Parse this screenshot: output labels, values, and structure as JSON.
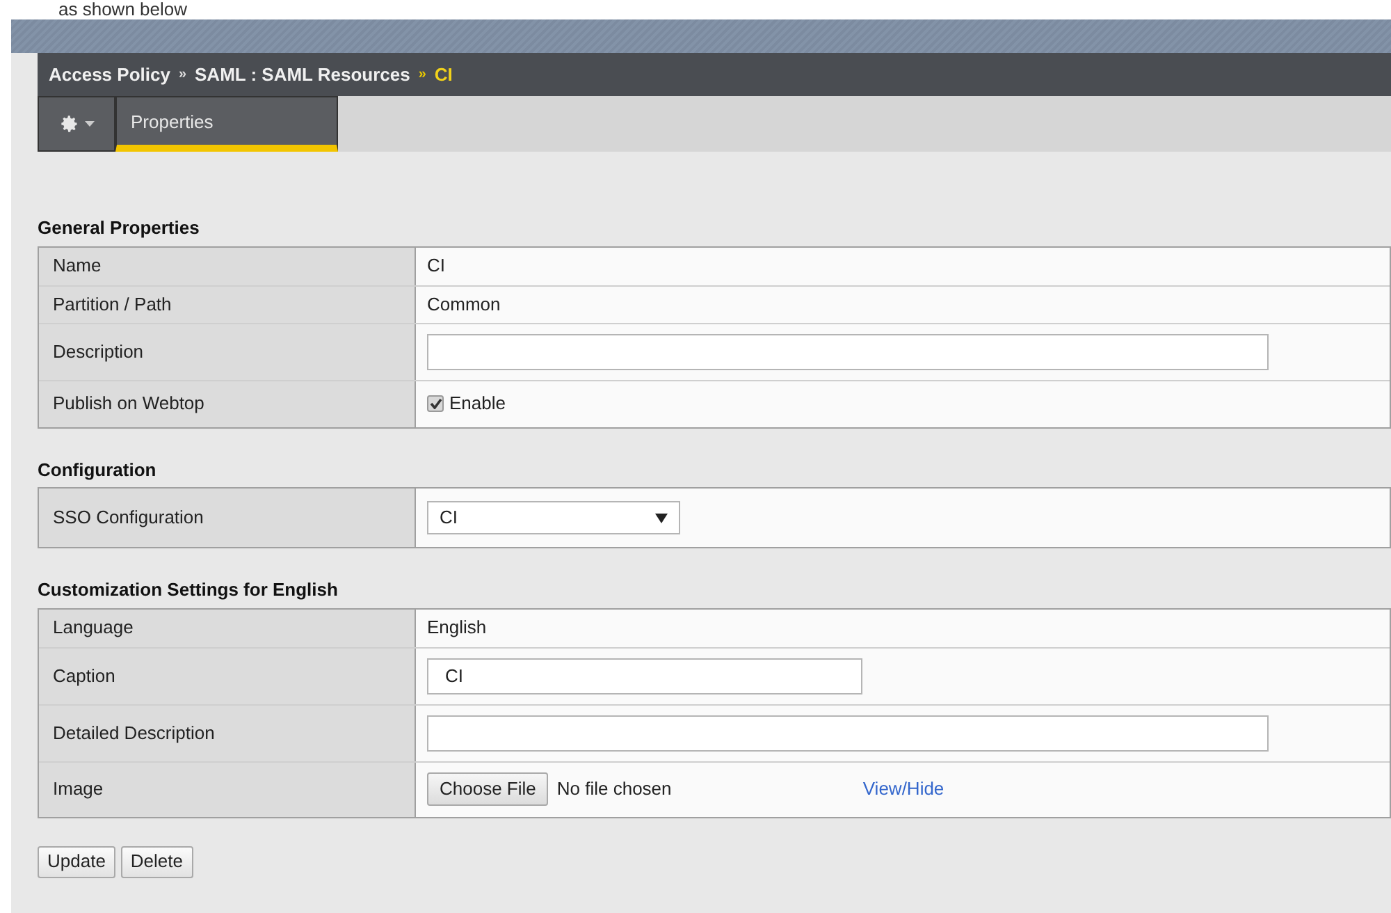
{
  "doc_caption": "as shown below",
  "breadcrumb": {
    "items": [
      "Access Policy",
      "SAML : SAML Resources"
    ],
    "current": "CI",
    "separator": "»"
  },
  "tabs": [
    {
      "label": "Properties",
      "selected": true
    }
  ],
  "sections": [
    {
      "title": "General Properties",
      "rows": [
        {
          "kind": "text",
          "label": "Name",
          "value": "CI"
        },
        {
          "kind": "text",
          "label": "Partition / Path",
          "value": "Common"
        },
        {
          "kind": "input",
          "label": "Description"
        },
        {
          "kind": "checkbox",
          "label": "Publish on Webtop",
          "checked": true,
          "option": "Enable"
        }
      ]
    },
    {
      "title": "Configuration",
      "rows": [
        {
          "kind": "select",
          "label": "SSO Configuration",
          "value": "CI"
        }
      ]
    },
    {
      "title": "Customization Settings for English",
      "rows": [
        {
          "kind": "text",
          "label": "Language",
          "value": "English"
        },
        {
          "kind": "short_input",
          "label": "Caption",
          "value": "CI"
        },
        {
          "kind": "input",
          "label": "Detailed Description"
        },
        {
          "kind": "file",
          "label": "Image",
          "button": "Choose File",
          "status": "No file chosen",
          "link": "View/Hide"
        }
      ]
    }
  ],
  "buttons": [
    "Update",
    "Delete"
  ]
}
